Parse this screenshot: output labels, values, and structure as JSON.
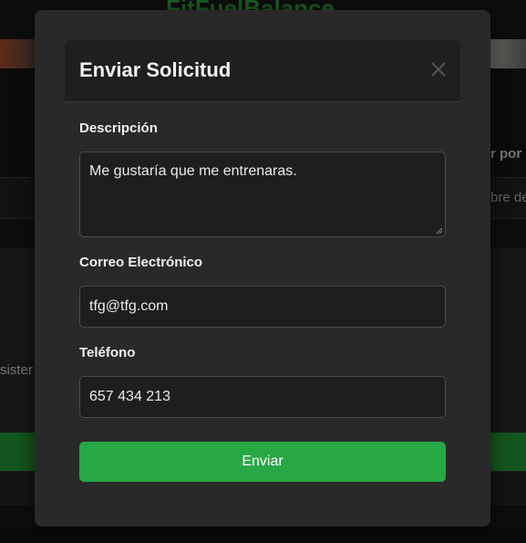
{
  "background": {
    "brand": "FitFuelBalance",
    "filter_label": "r por N",
    "input_text": "bre de",
    "card_text": "sister"
  },
  "modal": {
    "title": "Enviar Solicitud",
    "close_icon": "close-icon",
    "fields": {
      "description": {
        "label": "Descripción",
        "value": "Me gustaría que me entrenaras."
      },
      "email": {
        "label": "Correo Electrónico",
        "value": "tfg@tfg.com"
      },
      "phone": {
        "label": "Teléfono",
        "value": "657 434 213"
      }
    },
    "submit_label": "Enviar"
  },
  "colors": {
    "accent": "#28a745",
    "modal_bg": "#292929",
    "input_bg": "#1e1e1e"
  }
}
